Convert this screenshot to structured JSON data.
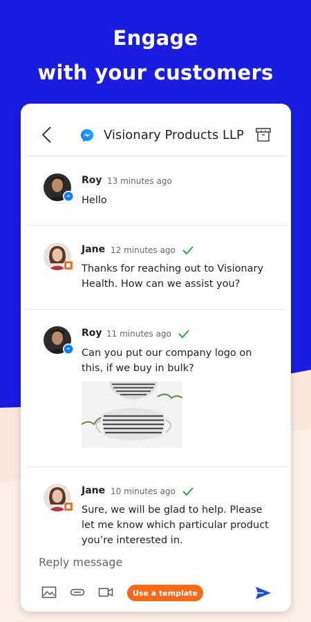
{
  "promo": {
    "headline_line1": "Engage",
    "headline_line2": "with your customers",
    "bg_color": "#1a1de0",
    "accent_color": "#fbe8dd"
  },
  "header": {
    "title": "Visionary Products LLP",
    "channel_icon": "messenger-icon"
  },
  "messages": [
    {
      "sender": "Roy",
      "time": "13 minutes ago",
      "text": "Hello",
      "channel": "messenger"
    },
    {
      "sender": "Jane",
      "time": "12 minutes ago",
      "text": "Thanks for reaching out to Visionary Health. How can we assist you?",
      "channel": "agent",
      "delivered": true
    },
    {
      "sender": "Roy",
      "time": "11 minutes ago",
      "text": "Can you put our company logo on this, if we buy in bulk?",
      "channel": "messenger",
      "delivered": true,
      "has_image": true
    },
    {
      "sender": "Jane",
      "time": "10 minutes ago",
      "text": "Sure, we will be glad to help. Please let me know which particular product you’re interested in.",
      "channel": "agent",
      "delivered": true
    }
  ],
  "composer": {
    "placeholder": "Reply message",
    "template_button": "Use a template",
    "template_color": "#f26a1b",
    "send_color": "#1f4fc9"
  }
}
